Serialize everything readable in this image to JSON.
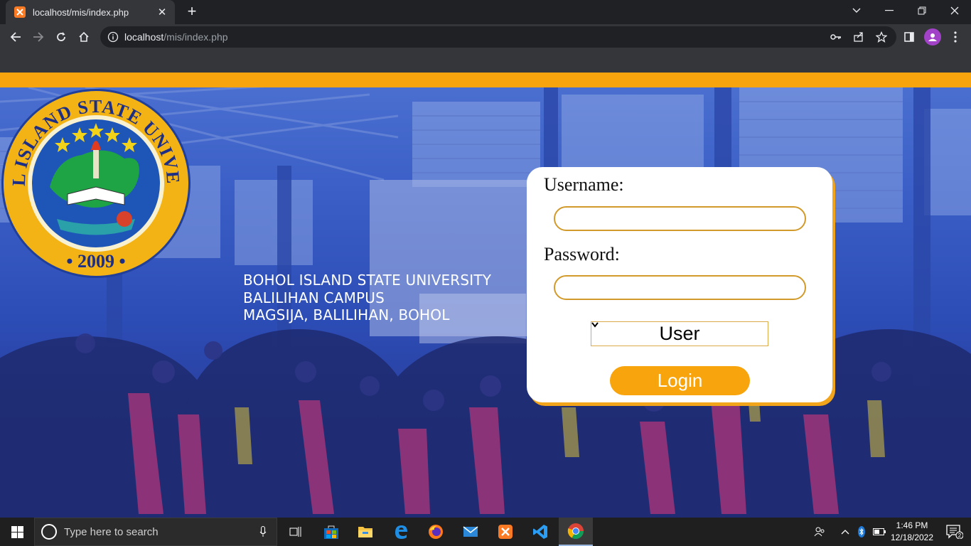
{
  "browser": {
    "tab_title": "localhost/mis/index.php",
    "url_host": "localhost",
    "url_path": "/mis/index.php"
  },
  "university": {
    "line1": "BOHOL ISLAND STATE UNIVERSITY",
    "line2": "BALILIHAN CAMPUS",
    "line3": "MAGSIJA, BALILIHAN, BOHOL",
    "seal_top_text": "BOHOL ISLAND STATE UNIVERSITY",
    "seal_year": "2009"
  },
  "login": {
    "username_label": "Username:",
    "password_label": "Password:",
    "username_value": "",
    "password_value": "",
    "role_selected": "User",
    "login_label": "Login"
  },
  "taskbar": {
    "search_placeholder": "Type here to search",
    "time": "1:46 PM",
    "date": "12/18/2022",
    "notification_count": "2"
  },
  "colors": {
    "accent": "#f8a40c",
    "hero_blue": "#3a5ec6",
    "chrome_dark": "#202124",
    "chrome_toolbar": "#35363a"
  }
}
